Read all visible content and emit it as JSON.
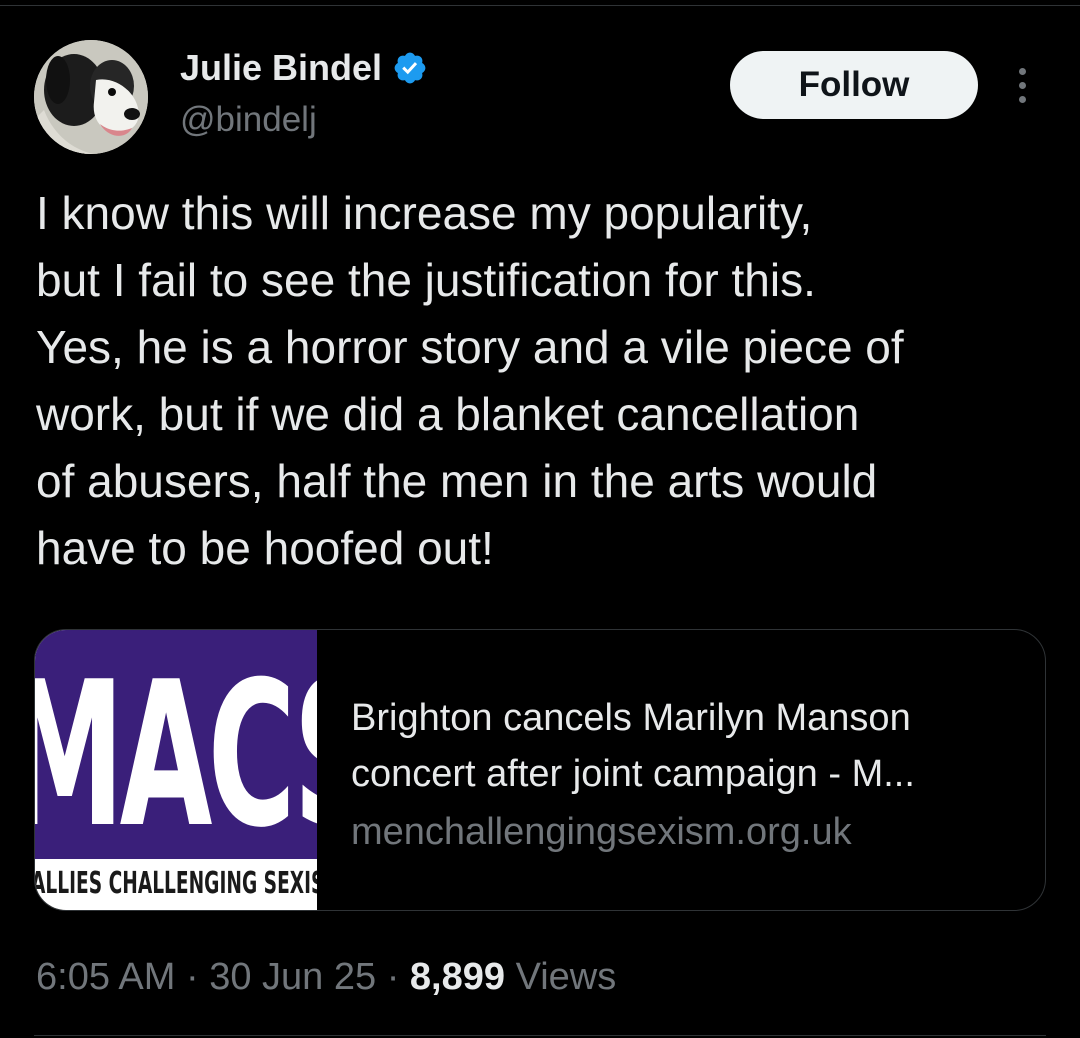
{
  "tweet": {
    "author": {
      "display_name": "Julie Bindel",
      "handle": "@bindelj",
      "verified": true,
      "verified_color": "#1d9bf0",
      "avatar_icon": "dog-avatar"
    },
    "follow_label": "Follow",
    "more_icon": "more-vertical-icon",
    "text_lines": [
      "I know this will increase my popularity,",
      "but I fail to see the justification for this.",
      "Yes, he is a horror story and a vile piece of",
      "work, but if we did a blanket cancellation",
      "of abusers, half the men in the arts would",
      "have to be hoofed out!"
    ],
    "link_card": {
      "thumbnail": {
        "logo_text": "MACS",
        "tagline": "ALLIES CHALLENGING SEXISM",
        "brand_color": "#3a1f7a"
      },
      "title_lines": [
        "Brighton cancels Marilyn Manson",
        "concert after joint campaign - M..."
      ],
      "domain": "menchallengingsexism.org.uk"
    },
    "meta": {
      "time": "6:05 AM",
      "separator": "·",
      "date": "30 Jun 25",
      "views_count": "8,899",
      "views_label": "Views"
    }
  },
  "colors": {
    "background": "#000000",
    "primary_text": "#e7e9ea",
    "secondary_text": "#71767b",
    "border": "#2f3336",
    "follow_button_bg": "#eff3f4"
  }
}
